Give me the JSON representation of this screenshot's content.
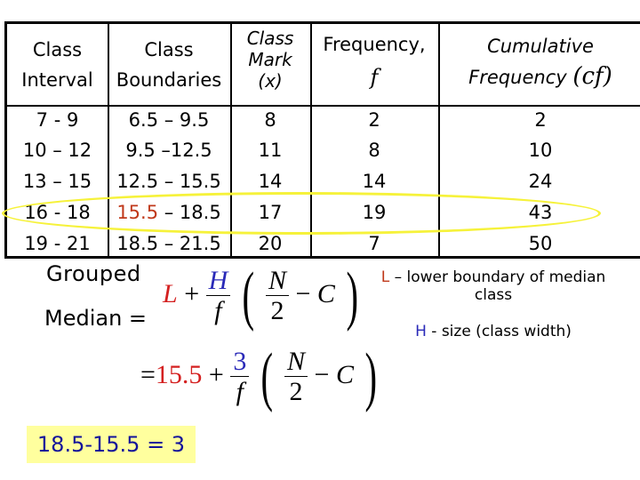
{
  "table": {
    "headers": [
      {
        "line1": "Class",
        "line2": "Interval"
      },
      {
        "line1": "Class",
        "line2": "Boundaries"
      },
      {
        "line1": "Class",
        "line2": "Mark",
        "line3": "(x)"
      },
      {
        "line1": "Frequency,",
        "symbol": "f"
      },
      {
        "line1": "Cumulative",
        "line2": "Frequency",
        "symbol": "(cf)"
      }
    ],
    "rows": [
      {
        "interval": "7  -  9",
        "boundaries": "6.5 – 9.5",
        "mark": "8",
        "frequency": "2",
        "cumulative": "2"
      },
      {
        "interval": "10  – 12",
        "boundaries": "9.5  –12.5",
        "mark": "11",
        "frequency": "8",
        "cumulative": "10"
      },
      {
        "interval": "13  – 15",
        "boundaries": "12.5 – 15.5",
        "mark": "14",
        "frequency": "14",
        "cumulative": "24"
      },
      {
        "interval": "16  - 18",
        "boundaries_lower": "15.5",
        "boundaries_rest": " – 18.5",
        "mark": "17",
        "frequency": "19",
        "cumulative": "43"
      },
      {
        "interval": "19 -  21",
        "boundaries": "18.5 – 21.5",
        "mark": "20",
        "frequency": "7",
        "cumulative": "50"
      }
    ],
    "highlighted_row": 3,
    "highlight_color": "#f6f23a",
    "lower_boundary_color": "#c0391b"
  },
  "median_label": {
    "line1": "Grouped",
    "line2": "Median ="
  },
  "formula_general": {
    "L": "L",
    "plus": "+",
    "H": "H",
    "f": "f",
    "N": "N",
    "two": "2",
    "minus": "−",
    "C": "C"
  },
  "formula_substituted": {
    "equals": "=",
    "L_value": "15.5",
    "plus": "+",
    "H_value": "3",
    "f": "f",
    "N": "N",
    "two": "2",
    "minus": "−",
    "C": "C"
  },
  "notes": {
    "L_symbol": "L",
    "L_text": " – lower boundary of median",
    "L_text2": "class",
    "H_symbol": "H",
    "H_text": " - size (class width)"
  },
  "class_width_box": {
    "text": "18.5-15.5 = 3",
    "background": "#ffff9e",
    "text_color": "#13139a"
  },
  "colors": {
    "red": "#c0391b",
    "blue": "#2a2ab8",
    "formula_red": "#d42020"
  }
}
